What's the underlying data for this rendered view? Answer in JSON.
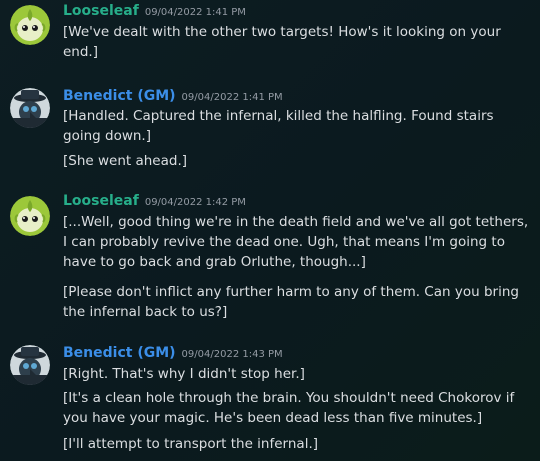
{
  "messages": [
    {
      "author": "Looseleaf",
      "timestamp": "09/04/2022 1:41 PM",
      "avatar_icon": "sprout-creature-avatar",
      "author_color": "#27ae8a",
      "lines": [
        "[We've dealt with the other two targets! How's it looking on your end.]"
      ]
    },
    {
      "author": "Benedict (GM)",
      "timestamp": "09/04/2022 1:41 PM",
      "avatar_icon": "plague-doctor-avatar",
      "author_color": "#3b8ee8",
      "lines": [
        "[Handled. Captured the infernal, killed the halfling. Found stairs going down.]",
        "[She went ahead.]"
      ]
    },
    {
      "author": "Looseleaf",
      "timestamp": "09/04/2022 1:42 PM",
      "avatar_icon": "sprout-creature-avatar",
      "author_color": "#27ae8a",
      "lines": [
        "[...Well, good thing we're in the death field and we've all got tethers, I can probably revive the dead one. Ugh, that means I'm going to have to go back and grab Orluthe, though...]",
        "[Please don't inflict any further harm to any of them. Can you bring the infernal back to us?]"
      ]
    },
    {
      "author": "Benedict (GM)",
      "timestamp": "09/04/2022 1:43 PM",
      "avatar_icon": "plague-doctor-avatar",
      "author_color": "#3b8ee8",
      "lines": [
        "[Right. That's why I didn't stop her.]",
        "[It's a clean hole through the brain. You shouldn't need Chokorov if you have your magic. He's been dead less than five minutes.]",
        "[I'll attempt to transport the infernal.]"
      ]
    }
  ]
}
